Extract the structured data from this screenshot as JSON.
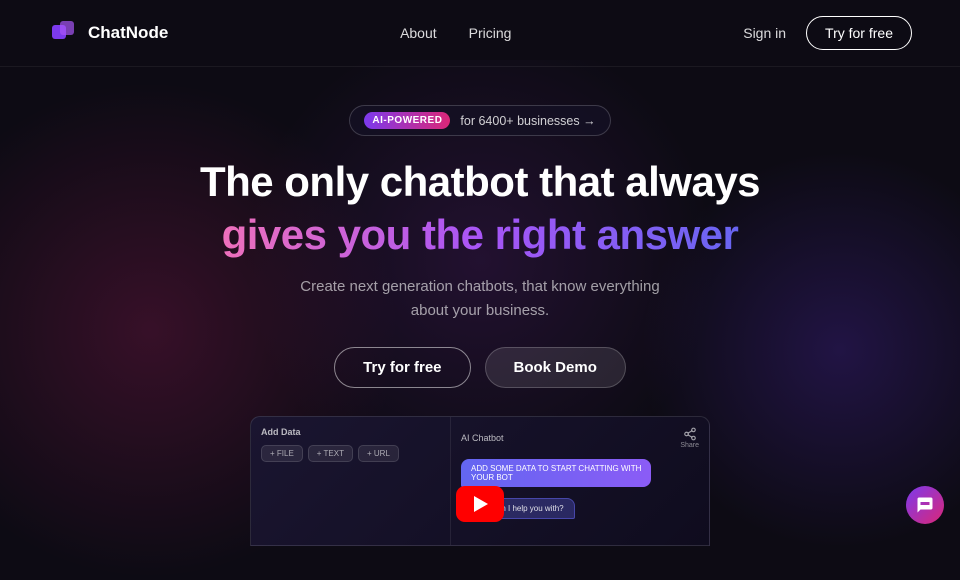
{
  "brand": {
    "name": "ChatNode",
    "logo_alt": "ChatNode logo"
  },
  "navbar": {
    "links": [
      {
        "label": "About",
        "id": "about"
      },
      {
        "label": "Pricing",
        "id": "pricing"
      }
    ],
    "signin_label": "Sign in",
    "try_free_label": "Try for free"
  },
  "hero": {
    "badge_pill": "AI-POWERED",
    "badge_text": "for 6400+ businesses →",
    "title_line1": "The only chatbot that always",
    "title_line2": "gives you the right answer",
    "subtitle": "Create next generation chatbots, that know everything about your business.",
    "btn_primary": "Try for free",
    "btn_secondary": "Book Demo"
  },
  "preview": {
    "left_title": "Add Data",
    "add_file": "+ FILE",
    "add_text": "+ TEXT",
    "add_url": "+ URL",
    "right_title": "AI Chatbot",
    "share_label": "Share",
    "chat_bubble_1": "ADD SOME DATA TO START CHATTING WITH YOUR BOT",
    "chat_bubble_2": "What can I help you with?"
  },
  "chat_widget": {
    "aria_label": "Open chat widget"
  },
  "colors": {
    "accent_gradient_start": "#f472b6",
    "accent_gradient_end": "#6366f1",
    "brand_purple": "#7c3aed",
    "brand_pink": "#db2777"
  }
}
